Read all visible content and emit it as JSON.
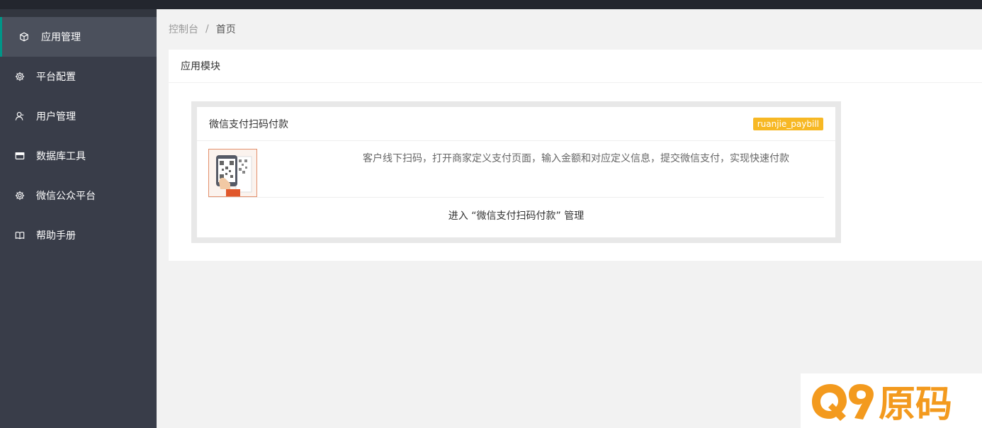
{
  "sidebar": {
    "items": [
      {
        "label": "应用管理",
        "icon": "cube-icon",
        "active": true
      },
      {
        "label": "平台配置",
        "icon": "gear-icon",
        "active": false
      },
      {
        "label": "用户管理",
        "icon": "user-icon",
        "active": false
      },
      {
        "label": "数据库工具",
        "icon": "window-icon",
        "active": false
      },
      {
        "label": "微信公众平台",
        "icon": "gear-icon",
        "active": false
      },
      {
        "label": "帮助手册",
        "icon": "book-icon",
        "active": false
      }
    ]
  },
  "breadcrumb": {
    "root": "控制台",
    "separator": "/",
    "current": "首页"
  },
  "card": {
    "title": "应用模块"
  },
  "module": {
    "title": "微信支付扫码付款",
    "tag": "ruanjie_paybill",
    "description": "客户线下扫码，打开商家定义支付页面，输入金额和对应定义信息，提交微信支付，实现快速付款",
    "enter_label": "进入 “微信支付扫码付款” 管理"
  },
  "watermark": {
    "text": "Q9原码"
  },
  "colors": {
    "sidebar_bg": "#393d49",
    "topbar_bg": "#23262e",
    "active_accent": "#009688",
    "tag_bg": "#f7b824",
    "watermark_orange": "#f39a1e"
  }
}
